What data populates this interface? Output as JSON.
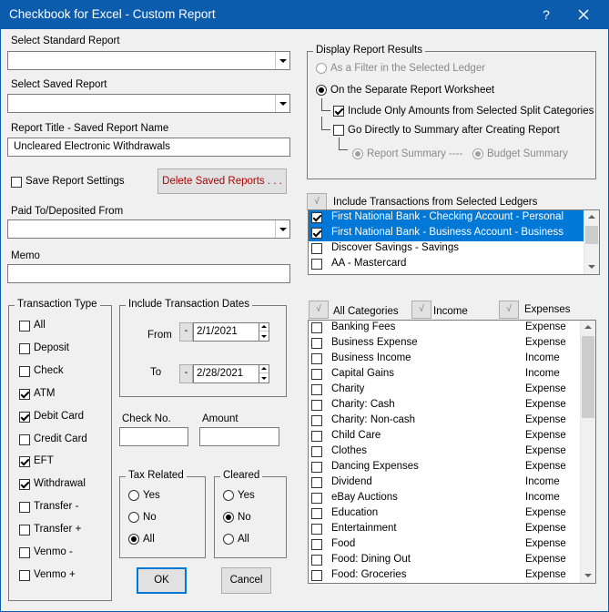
{
  "window": {
    "title": "Checkbook for Excel - Custom Report",
    "help": "?"
  },
  "left": {
    "standard_report_label": "Select Standard Report",
    "standard_report_value": "",
    "saved_report_label": "Select Saved Report",
    "saved_report_value": "",
    "report_title_label": "Report Title - Saved Report Name",
    "report_title_value": "Uncleared Electronic Withdrawals",
    "save_settings_label": "Save Report Settings",
    "delete_saved_label": "Delete Saved Reports . . .",
    "paid_to_label": "Paid To/Deposited From",
    "paid_to_value": "",
    "memo_label": "Memo",
    "memo_value": ""
  },
  "display": {
    "group_title": "Display Report Results",
    "filter_label": "As a Filter in the Selected Ledger",
    "separate_label": "On the Separate Report Worksheet",
    "include_split_label": "Include Only Amounts from Selected Split Categories",
    "go_summary_label": "Go Directly to Summary after Creating Report",
    "report_summary_label": "Report Summary",
    "dashes": "----",
    "budget_summary_label": "Budget Summary"
  },
  "ledgers": {
    "header_btn": "√",
    "header_label": "Include Transactions from Selected Ledgers",
    "items": [
      {
        "label": "First National Bank - Checking Account - Personal",
        "checked": true,
        "selected": true
      },
      {
        "label": "First National Bank - Business Account - Business",
        "checked": true,
        "selected": true
      },
      {
        "label": "Discover Savings - Savings",
        "checked": false,
        "selected": false
      },
      {
        "label": "AA - Mastercard",
        "checked": false,
        "selected": false
      }
    ]
  },
  "transaction_type": {
    "group_title": "Transaction Type",
    "items": [
      {
        "label": "All",
        "checked": false
      },
      {
        "label": "Deposit",
        "checked": false
      },
      {
        "label": "Check",
        "checked": false
      },
      {
        "label": "ATM",
        "checked": true
      },
      {
        "label": "Debit Card",
        "checked": true
      },
      {
        "label": "Credit Card",
        "checked": false
      },
      {
        "label": "EFT",
        "checked": true
      },
      {
        "label": "Withdrawal",
        "checked": true
      },
      {
        "label": "Transfer -",
        "checked": false
      },
      {
        "label": "Transfer +",
        "checked": false
      },
      {
        "label": "Venmo -",
        "checked": false
      },
      {
        "label": "Venmo +",
        "checked": false
      }
    ]
  },
  "dates": {
    "group_title": "Include Transaction Dates",
    "from_label": "From",
    "from_btn": "-",
    "from_value": "2/1/2021",
    "to_label": "To",
    "to_btn": "-",
    "to_value": "2/28/2021"
  },
  "check_no": {
    "label": "Check No.",
    "value": ""
  },
  "amount": {
    "label": "Amount",
    "value": ""
  },
  "tax_related": {
    "group_title": "Tax Related",
    "options": [
      {
        "label": "Yes",
        "checked": false
      },
      {
        "label": "No",
        "checked": false
      },
      {
        "label": "All",
        "checked": true
      }
    ]
  },
  "cleared": {
    "group_title": "Cleared",
    "options": [
      {
        "label": "Yes",
        "checked": false
      },
      {
        "label": "No",
        "checked": true
      },
      {
        "label": "All",
        "checked": false
      }
    ]
  },
  "buttons": {
    "ok": "OK",
    "cancel": "Cancel"
  },
  "categories": {
    "all_btn": "√",
    "all_label": "All Categories",
    "income_btn": "√",
    "income_label": "Income",
    "expenses_btn": "√",
    "expenses_label": "Expenses",
    "items": [
      {
        "name": "Banking Fees",
        "type": "Expense"
      },
      {
        "name": "Business Expense",
        "type": "Expense"
      },
      {
        "name": "Business Income",
        "type": "Income"
      },
      {
        "name": "Capital Gains",
        "type": "Income"
      },
      {
        "name": "Charity",
        "type": "Expense"
      },
      {
        "name": "Charity: Cash",
        "type": "Expense"
      },
      {
        "name": "Charity: Non-cash",
        "type": "Expense"
      },
      {
        "name": "Child Care",
        "type": "Expense"
      },
      {
        "name": "Clothes",
        "type": "Expense"
      },
      {
        "name": "Dancing Expenses",
        "type": "Expense"
      },
      {
        "name": "Dividend",
        "type": "Income"
      },
      {
        "name": "eBay Auctions",
        "type": "Income"
      },
      {
        "name": "Education",
        "type": "Expense"
      },
      {
        "name": "Entertainment",
        "type": "Expense"
      },
      {
        "name": "Food",
        "type": "Expense"
      },
      {
        "name": "Food: Dining Out",
        "type": "Expense"
      },
      {
        "name": "Food: Groceries",
        "type": "Expense"
      }
    ]
  }
}
